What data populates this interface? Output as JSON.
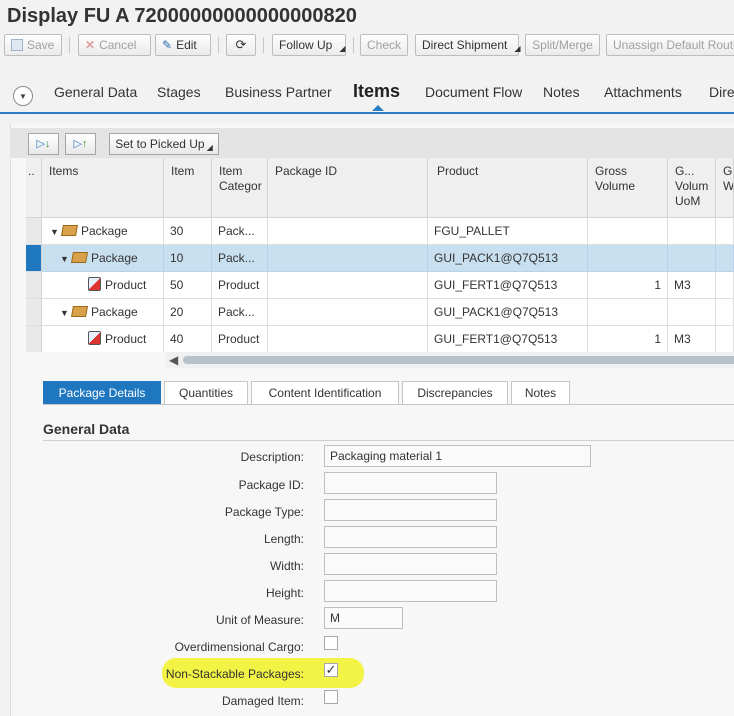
{
  "title": "Display FU A 72000000000000000820",
  "toolbar": {
    "save": "Save",
    "cancel": "Cancel",
    "edit": "Edit",
    "follow_up": "Follow Up",
    "check": "Check",
    "direct_shipment": "Direct Shipment",
    "split_merge": "Split/Merge",
    "unassign": "Unassign Default Route"
  },
  "tabs": [
    "General Data",
    "Stages",
    "Business Partner",
    "Items",
    "Document Flow",
    "Notes",
    "Attachments",
    "Dire"
  ],
  "active_tab": "Items",
  "grid_toolbar": {
    "set_picked_up": "Set to Picked Up"
  },
  "table": {
    "columns": [
      "..",
      "Items",
      "Item",
      "Item Categor",
      "Package ID",
      "Product",
      "Gross Volume",
      "G... Volum UoM",
      "G W"
    ],
    "rows": [
      {
        "level": 0,
        "type": "Package",
        "expanded": true,
        "item": "30",
        "category": "Pack...",
        "package_id": "",
        "product": "FGU_PALLET",
        "gross_volume": "",
        "uom": "",
        "selected": false
      },
      {
        "level": 1,
        "type": "Package",
        "expanded": true,
        "item": "10",
        "category": "Pack...",
        "package_id": "",
        "product": "GUI_PACK1@Q7Q513",
        "gross_volume": "",
        "uom": "",
        "selected": true
      },
      {
        "level": 2,
        "type": "Product",
        "expanded": false,
        "item": "50",
        "category": "Product",
        "package_id": "",
        "product": "GUI_FERT1@Q7Q513",
        "gross_volume": "1",
        "uom": "M3",
        "selected": false
      },
      {
        "level": 1,
        "type": "Package",
        "expanded": true,
        "item": "20",
        "category": "Pack...",
        "package_id": "",
        "product": "GUI_PACK1@Q7Q513",
        "gross_volume": "",
        "uom": "",
        "selected": false
      },
      {
        "level": 2,
        "type": "Product",
        "expanded": false,
        "item": "40",
        "category": "Product",
        "package_id": "",
        "product": "GUI_FERT1@Q7Q513",
        "gross_volume": "1",
        "uom": "M3",
        "selected": false
      }
    ]
  },
  "subtabs": [
    "Package Details",
    "Quantities",
    "Content Identification",
    "Discrepancies",
    "Notes"
  ],
  "active_subtab": "Package Details",
  "form": {
    "section_title": "General Data",
    "description_label": "Description:",
    "description_value": "Packaging material 1",
    "package_id_label": "Package ID:",
    "package_id_value": "",
    "package_type_label": "Package Type:",
    "package_type_value": "",
    "length_label": "Length:",
    "length_value": "",
    "width_label": "Width:",
    "width_value": "",
    "height_label": "Height:",
    "height_value": "",
    "uom_label": "Unit of Measure:",
    "uom_value": "M",
    "overdimensional_label": "Overdimensional Cargo:",
    "overdimensional_checked": false,
    "non_stackable_label": "Non-Stackable Packages:",
    "non_stackable_checked": true,
    "damaged_label": "Damaged Item:",
    "damaged_checked": false
  },
  "colors": {
    "accent": "#1f77c0",
    "selected_row": "#c8dff0",
    "highlight": "#f1f23a"
  }
}
